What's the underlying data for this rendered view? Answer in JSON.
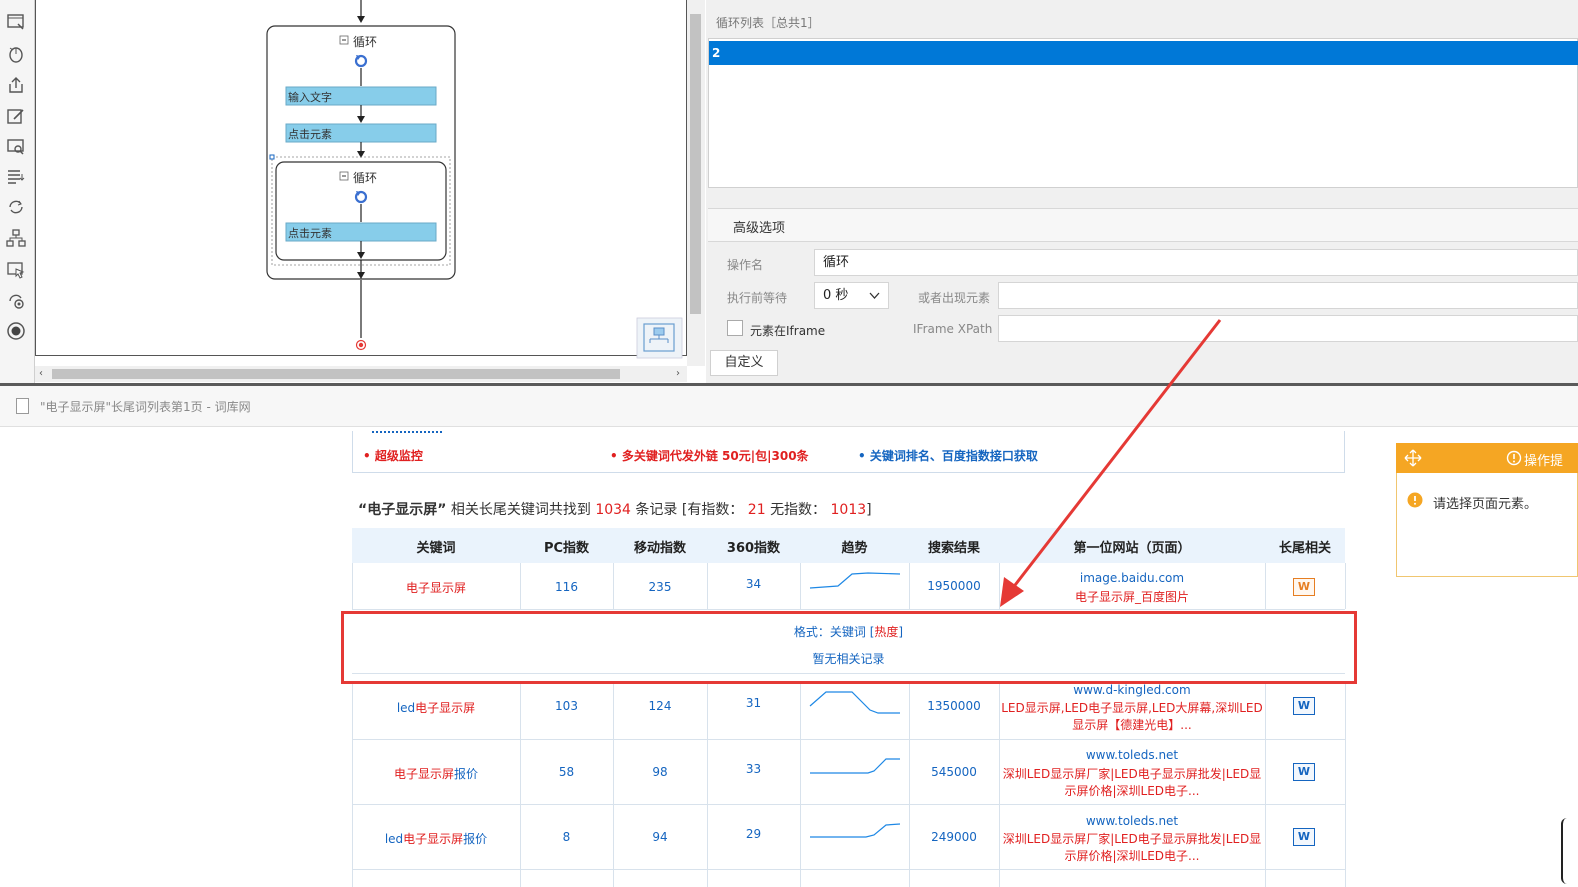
{
  "flow": {
    "loop_outer": "循环",
    "loop_inner": "循环",
    "step_input": "输入文字",
    "step_click1": "点击元素",
    "step_click2": "点击元素"
  },
  "panel": {
    "list_title": "循环列表［总共1］",
    "list_selected": "2",
    "advanced_tab": "高级选项",
    "op_name_label": "操作名",
    "op_name_value": "循环",
    "wait_label": "执行前等待",
    "wait_value": "0 秒",
    "or_element_label": "或者出现元素",
    "in_iframe_label": "元素在Iframe",
    "iframe_xpath_label": "IFrame XPath",
    "custom_button": "自定义"
  },
  "browser": {
    "tab_title": "\"电子显示屏\"长尾词列表第1页 - 词库网"
  },
  "promo": {
    "item1": "• 超级监控",
    "item2": "• 多关键词代发外链 50元|包|300条",
    "item3": "• 关键词排名、百度指数接口获取"
  },
  "summary": {
    "keyword": "“电子显示屏”",
    "t1": "相关长尾关键词共找到",
    "total": "1034",
    "t2": "条记录 [有指数：",
    "with_index": "21",
    "t3": "无指数：",
    "without_index": "1013",
    "t4": "]"
  },
  "table": {
    "headers": [
      "关键词",
      "PC指数",
      "移动指数",
      "360指数",
      "趋势",
      "搜索结果",
      "第一位网站（页面）",
      "长尾相关"
    ],
    "rows": [
      {
        "kw_red": "电子显示屏",
        "kw_blue": "",
        "pc": "116",
        "mobile": "235",
        "s360": "34",
        "results": "1950000",
        "site": "image.baidu.com",
        "title1": "电子显示屏_百度图片",
        "title2": ""
      },
      {
        "kw_blue": "led",
        "kw_red": "电子显示屏",
        "pc": "103",
        "mobile": "124",
        "s360": "31",
        "results": "1350000",
        "site": "www.d-kingled.com",
        "title1": "LED显示屏,LED电子显示屏,LED大屏幕,深圳LED",
        "title2": "显示屏【德建光电】..."
      },
      {
        "kw_red": "电子显示屏",
        "kw_blue": "报价",
        "pc": "58",
        "mobile": "98",
        "s360": "33",
        "results": "545000",
        "site": "www.toleds.net",
        "title1": "深圳LED显示屏厂家|LED电子显示屏批发|LED显",
        "title2": "示屏价格|深圳LED电子..."
      },
      {
        "kw_blue": "led",
        "kw_red": "电子显示屏",
        "kw_blue2": "报价",
        "pc": "8",
        "mobile": "94",
        "s360": "29",
        "results": "249000",
        "site": "www.toleds.net",
        "title1": "深圳LED显示屏厂家|LED电子显示屏批发|LED显",
        "title2": "示屏价格|深圳LED电子..."
      }
    ],
    "expanded": {
      "format_label": "格式：关键词 [",
      "format_hot": "热度",
      "format_end": "]",
      "empty": "暂无相关记录"
    },
    "w_icon": "W"
  },
  "tip": {
    "header": "操作提",
    "message": "请选择页面元素。"
  },
  "colors": {
    "accent_blue": "#0078d7",
    "highlight_red": "#e53935",
    "tip_orange": "#f5a623",
    "flow_box": "#87cdea"
  }
}
